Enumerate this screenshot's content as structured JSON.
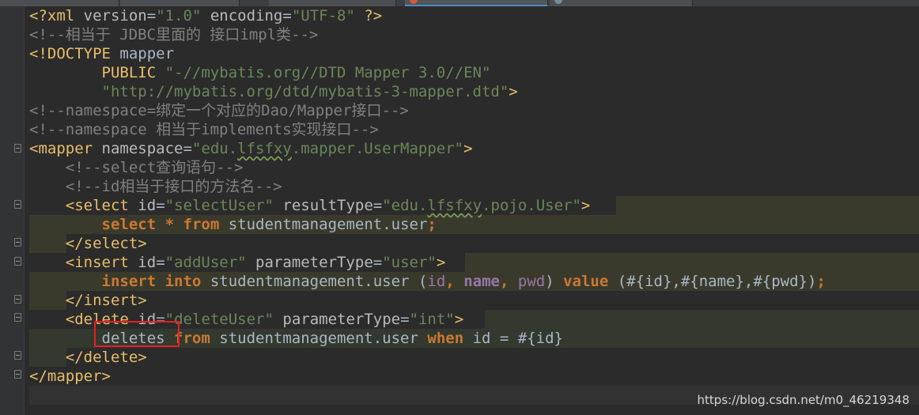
{
  "watermark": "https://blog.csdn.net/m0_46219348",
  "lines": {
    "l1": {
      "open": "<?",
      "tag": "xml",
      "a1": "version",
      "v1": "\"1.0\"",
      "a2": "encoding",
      "v2": "\"UTF-8\"",
      "close": "?>"
    },
    "l2": {
      "comment": "<!--相当于 JDBC里面的 接口impl类-->"
    },
    "l3": {
      "doctype": "<!DOCTYPE",
      "name": "mapper"
    },
    "l4": {
      "public": "PUBLIC",
      "id": "\"-//mybatis.org//DTD Mapper 3.0//EN\""
    },
    "l5": {
      "url": "\"http://mybatis.org/dtd/mybatis-3-mapper.dtd\"",
      "end": ">"
    },
    "l6": {
      "comment": "<!--namespace=绑定一个对应的Dao/Mapper接口-->"
    },
    "l7": {
      "comment": "<!--namespace 相当于implements实现接口-->"
    },
    "l8": {
      "tag": "<mapper",
      "attr": "namespace",
      "val_q1": "\"edu.",
      "val_sq": "lfsfxy",
      "val_rest": ".mapper.UserMapper\"",
      "end": ">"
    },
    "l9": {
      "comment": "<!--select查询语句-->"
    },
    "l10": {
      "comment": "<!--id相当于接口的方法名-->"
    },
    "l11": {
      "tag": "<select",
      "a1": "id",
      "v1": "\"selectUser\"",
      "a2": "resultType",
      "v2_q1": "\"edu.",
      "v2_sq": "lfsfxy",
      "v2_rest": ".pojo.User\"",
      "end": ">"
    },
    "l12": {
      "kw1": "select",
      "star": "*",
      "kw2": "from",
      "table": "studentmanagement.user",
      "semi": ";"
    },
    "l13": {
      "tag": "</select>"
    },
    "l14": {
      "tag": "<insert",
      "a1": "id",
      "v1": "\"addUser\"",
      "a2": "parameterType",
      "v2": "\"user\"",
      "end": ">"
    },
    "l15": {
      "kw1": "insert",
      "kw2": "into",
      "table": "studentmanagement.user",
      "p_open": "(",
      "c1": "id",
      "comma1": ",",
      "c2": "name",
      "comma2": ",",
      "c3": "pwd",
      "p_close": ")",
      "kw3": "value",
      "values": "(#{id},#{name},#{pwd})",
      "semi": ";"
    },
    "l16": {
      "tag": "</insert>"
    },
    "l17": {
      "tag": "<delete",
      "a1": "id",
      "v1": "\"deleteUser\"",
      "a2": "parameterType",
      "v2": "\"int\"",
      "end": ">"
    },
    "l18": {
      "word": "deletes",
      "kw1": "from",
      "table": "studentmanagement.user",
      "kw2": "when",
      "cond": "id = #{id}"
    },
    "l19": {
      "tag": "</delete>"
    },
    "l20": {
      "tag": "</mapper>"
    }
  }
}
